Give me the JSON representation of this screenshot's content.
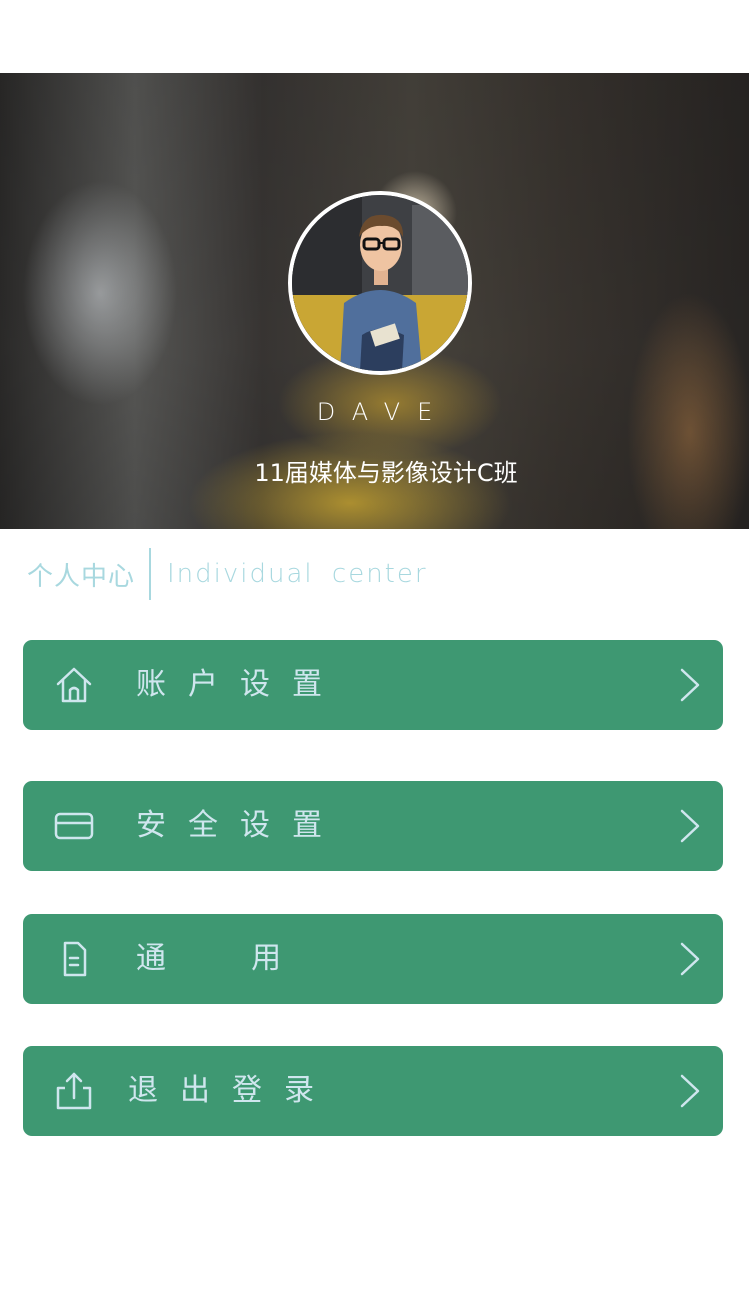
{
  "profile": {
    "name": "DAVE",
    "class_name": "11届媒体与影像设计C班"
  },
  "section": {
    "title_cn": "个人中心",
    "title_en": "Individual center"
  },
  "menu": [
    {
      "label": "账户设置",
      "icon": "home-icon"
    },
    {
      "label": "安全设置",
      "icon": "card-icon"
    },
    {
      "label": "通  用",
      "icon": "document-icon"
    },
    {
      "label": "退出登录",
      "icon": "share-icon"
    }
  ],
  "colors": {
    "menu_background": "#3e9872",
    "menu_text": "#cfe6ee",
    "section_text": "#a8d8df",
    "hero_text": "#ffffff"
  }
}
